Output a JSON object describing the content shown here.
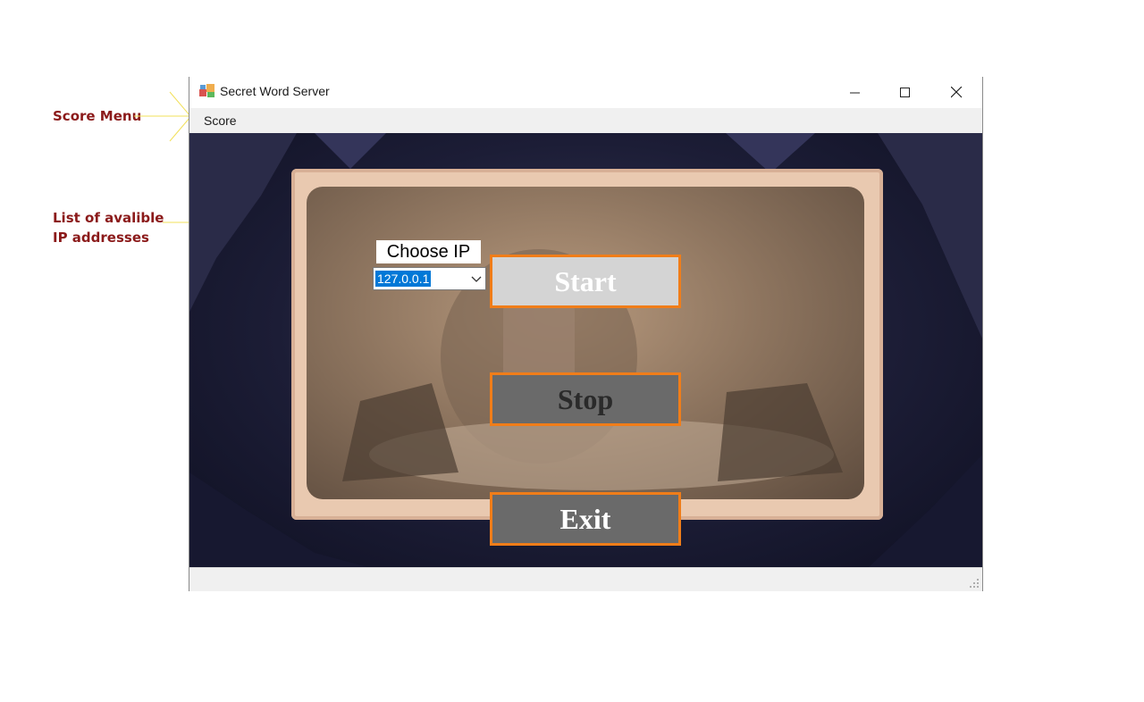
{
  "annotations": {
    "score_menu": "Score Menu",
    "ip_list_line1": "List of avalible",
    "ip_list_line2": "IP addresses"
  },
  "window": {
    "title": "Secret Word Server",
    "controls": [
      "minimize-icon",
      "maximize-icon",
      "close-icon"
    ]
  },
  "menu": {
    "score": "Score"
  },
  "ip_picker": {
    "label": "Choose IP",
    "selected": "127.0.0.1"
  },
  "buttons": {
    "start": "Start",
    "stop": "Stop",
    "exit": "Exit"
  },
  "colors": {
    "button_border": "#f07d19",
    "annotation_text": "#8b1a1a",
    "annotation_line": "#f2e05a",
    "selection": "#0078d7"
  }
}
